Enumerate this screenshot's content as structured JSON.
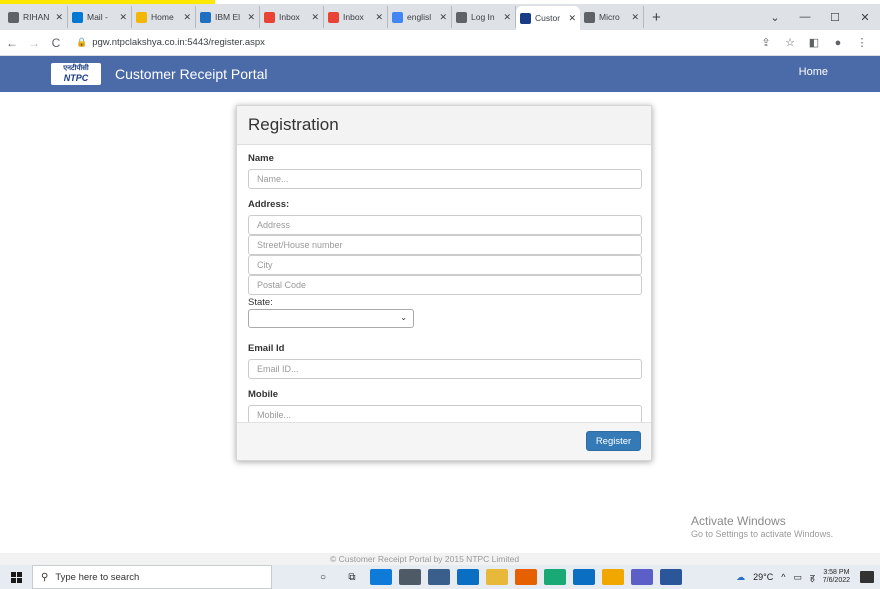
{
  "browser": {
    "tabs": [
      {
        "label": "RIHAN",
        "color": "#5f6368",
        "icon": "chrome-icon"
      },
      {
        "label": "Mail -",
        "color": "#0078d4",
        "icon": "outlook-icon"
      },
      {
        "label": "Home",
        "color": "#f2b705",
        "icon": "home-favicon"
      },
      {
        "label": "IBM El",
        "color": "#1f70c1",
        "icon": "ibm-favicon"
      },
      {
        "label": "Inbox",
        "color": "#ea4335",
        "icon": "gmail-icon"
      },
      {
        "label": "Inbox",
        "color": "#ea4335",
        "icon": "gmail-icon"
      },
      {
        "label": "englisl",
        "color": "#4285f4",
        "icon": "google-icon"
      },
      {
        "label": "Log In",
        "color": "#5f6368",
        "icon": "globe-icon"
      },
      {
        "label": "Custor",
        "color": "#1a3c86",
        "icon": "portal-favicon",
        "active": true
      },
      {
        "label": "Micro",
        "color": "#5f6368",
        "icon": "globe-icon"
      }
    ],
    "url": "pgw.ntpclakshya.co.in:5443/register.aspx"
  },
  "site": {
    "logo_line1": "एनटीपीसी",
    "logo_line2": "NTPC",
    "title": "Customer Receipt Portal",
    "nav_home": "Home"
  },
  "form": {
    "heading": "Registration",
    "name_label": "Name",
    "name_placeholder": "Name...",
    "address_label": "Address:",
    "address_placeholder": "Address",
    "street_placeholder": "Street/House number",
    "city_placeholder": "City",
    "postal_placeholder": "Postal Code",
    "state_label": "State:",
    "state_value": "",
    "email_label": "Email Id",
    "email_placeholder": "Email ID...",
    "mobile_label": "Mobile",
    "mobile_placeholder": "Mobile...",
    "register_button": "Register"
  },
  "watermark": {
    "line1": "Activate Windows",
    "line2": "Go to Settings to activate Windows."
  },
  "footer_text": "© Customer Receipt Portal by 2015 NTPC Limited",
  "taskbar": {
    "search_placeholder": "Type here to search",
    "apps": [
      {
        "icon": "cortana-icon",
        "color": "#222"
      },
      {
        "icon": "task-view-icon",
        "color": "#222"
      },
      {
        "icon": "edge-icon",
        "color": "#0f7bd8"
      },
      {
        "icon": "calculator-icon",
        "color": "#4e5a66"
      },
      {
        "icon": "store-icon",
        "color": "#3a5f8c"
      },
      {
        "icon": "mail-icon",
        "color": "#0a6fc2"
      },
      {
        "icon": "file-explorer-icon",
        "color": "#e8b83b"
      },
      {
        "icon": "firefox-icon",
        "color": "#e66000"
      },
      {
        "icon": "dev-tool-icon",
        "color": "#19a974"
      },
      {
        "icon": "outlook-icon",
        "color": "#0a6fc2"
      },
      {
        "icon": "chrome-icon",
        "color": "#f2a600"
      },
      {
        "icon": "teams-icon",
        "color": "#5b5fc7"
      },
      {
        "icon": "word-icon",
        "color": "#2b579a"
      }
    ],
    "weather": "29°C",
    "time": "3:58 PM",
    "date": "7/6/2022"
  }
}
